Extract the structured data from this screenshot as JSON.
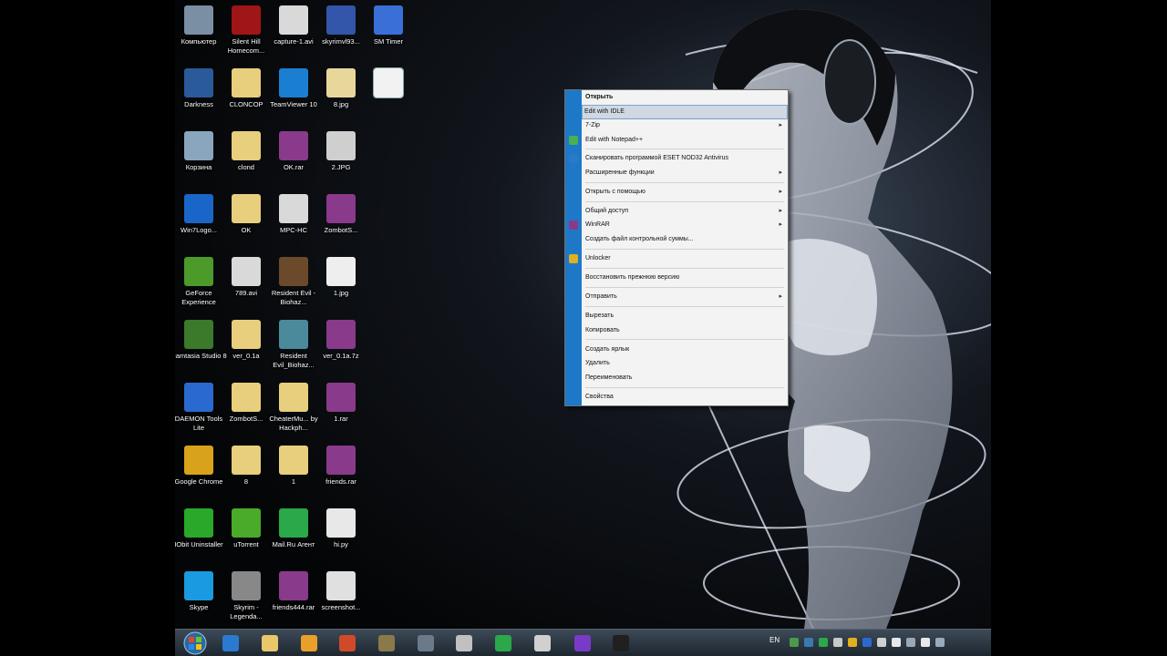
{
  "desktop": {
    "icons": [
      {
        "label": "Компьютер",
        "color": "#7a8fa3"
      },
      {
        "label": "Silent Hill Homecom...",
        "color": "#a01515"
      },
      {
        "label": "capture-1.avi",
        "color": "#d9d9d9"
      },
      {
        "label": "skyrimvl93...",
        "color": "#3355aa"
      },
      {
        "label": "SM Timer",
        "color": "#3a6fd8"
      },
      {
        "label": "Darkness",
        "color": "#2a5a9a"
      },
      {
        "label": "CLONCOP",
        "color": "#e8cf7e"
      },
      {
        "label": "TeamViewer 10",
        "color": "#1a7fd0"
      },
      {
        "label": "8.jpg",
        "color": "#e8d79a"
      },
      {
        "label": "",
        "color": "#f2f2f2"
      },
      {
        "label": "Корзина",
        "color": "#8aa6bf"
      },
      {
        "label": "clond",
        "color": "#e8cf7e"
      },
      {
        "label": "OK.rar",
        "color": "#8a3a8a"
      },
      {
        "label": "2.JPG",
        "color": "#cfcfcf"
      },
      {
        "label": "Win7Logo...",
        "color": "#1a66c8"
      },
      {
        "label": "OK",
        "color": "#e8cf7e"
      },
      {
        "label": "MPC-HC",
        "color": "#d9d9d9"
      },
      {
        "label": "ZombotS...",
        "color": "#8a3a8a"
      },
      {
        "label": "GeForce Experience",
        "color": "#4c9a2a"
      },
      {
        "label": "789.avi",
        "color": "#d9d9d9"
      },
      {
        "label": "Resident Evil - Biohaz...",
        "color": "#6a4a2a"
      },
      {
        "label": "1.jpg",
        "color": "#eeeeee"
      },
      {
        "label": "Camtasia Studio 8",
        "color": "#3a7a2a"
      },
      {
        "label": "ver_0.1a",
        "color": "#e8cf7e"
      },
      {
        "label": "Resident Evil_Biohaz...",
        "color": "#4a8a9a"
      },
      {
        "label": "ver_0.1a.7z",
        "color": "#8a3a8a"
      },
      {
        "label": "DAEMON Tools Lite",
        "color": "#2a6ad0"
      },
      {
        "label": "ZombotS...",
        "color": "#e8cf7e"
      },
      {
        "label": "CheaterMu... by Hackph...",
        "color": "#e8cf7e"
      },
      {
        "label": "1.rar",
        "color": "#8a3a8a"
      },
      {
        "label": "Google Chrome",
        "color": "#d8a21a"
      },
      {
        "label": "8",
        "color": "#e8cf7e"
      },
      {
        "label": "1",
        "color": "#e8cf7e"
      },
      {
        "label": "friends.rar",
        "color": "#8a3a8a"
      },
      {
        "label": "IObit Uninstaller",
        "color": "#2aa82a"
      },
      {
        "label": "uTorrent",
        "color": "#4aaa2a"
      },
      {
        "label": "Mail.Ru Агент",
        "color": "#2aa84a"
      },
      {
        "label": "hi.py",
        "color": "#e8e8e8"
      },
      {
        "label": "Skype",
        "color": "#1a9ae0"
      },
      {
        "label": "Skyrim - Legenda...",
        "color": "#888888"
      },
      {
        "label": "friends444.rar",
        "color": "#8a3a8a"
      },
      {
        "label": "screenshot...",
        "color": "#e0e0e0"
      }
    ]
  },
  "context_menu": {
    "items": [
      {
        "label": "Открыть",
        "bold": true
      },
      {
        "label": "Edit with IDLE",
        "highlighted": true
      },
      {
        "label": "7-Zip",
        "submenu": true
      },
      {
        "label": "Edit with Notepad++",
        "icon_color": "#4caf50"
      },
      {
        "label": "Сканировать программой ESET NOD32 Antivirus",
        "icon_color": "#2a7ac8"
      },
      {
        "label": "Расширенные функции",
        "submenu": true
      },
      {
        "label": "Открыть с помощью",
        "submenu": true
      },
      {
        "label": "Общий доступ",
        "submenu": true
      },
      {
        "label": "WinRAR",
        "submenu": true,
        "icon_color": "#8a3a8a"
      },
      {
        "label": "Создать файл контрольной суммы..."
      },
      {
        "label": "Unlocker",
        "icon_color": "#e0b020"
      },
      {
        "label": "Восстановить прежнюю версию"
      },
      {
        "label": "Отправить",
        "submenu": true
      },
      {
        "label": "Вырезать"
      },
      {
        "label": "Копировать"
      },
      {
        "label": "Создать ярлык"
      },
      {
        "label": "Удалить"
      },
      {
        "label": "Переименовать"
      },
      {
        "label": "Свойства"
      }
    ],
    "submenu_arrow": "▸"
  },
  "taskbar": {
    "buttons": [
      {
        "name": "taskbar-ie",
        "color": "#2a7ad0"
      },
      {
        "name": "taskbar-explorer",
        "color": "#e8c86a"
      },
      {
        "name": "taskbar-media",
        "color": "#e8a02a"
      },
      {
        "name": "taskbar-chrome",
        "color": "#d04a2a"
      },
      {
        "name": "taskbar-minecraft",
        "color": "#8a7a4a"
      },
      {
        "name": "taskbar-app",
        "color": "#6a7a8a"
      },
      {
        "name": "taskbar-tool",
        "color": "#c0c0c0"
      },
      {
        "name": "taskbar-mailru",
        "color": "#2aa84a"
      },
      {
        "name": "taskbar-python",
        "color": "#d0d0d0"
      },
      {
        "name": "taskbar-visualstudio",
        "color": "#7a3ac8"
      },
      {
        "name": "taskbar-cmd",
        "color": "#202020"
      }
    ],
    "language": "EN"
  },
  "colors": {
    "accent": "#1e78c8",
    "menu_bg": "#f3f3f3",
    "highlight": "#cfd8e3"
  }
}
